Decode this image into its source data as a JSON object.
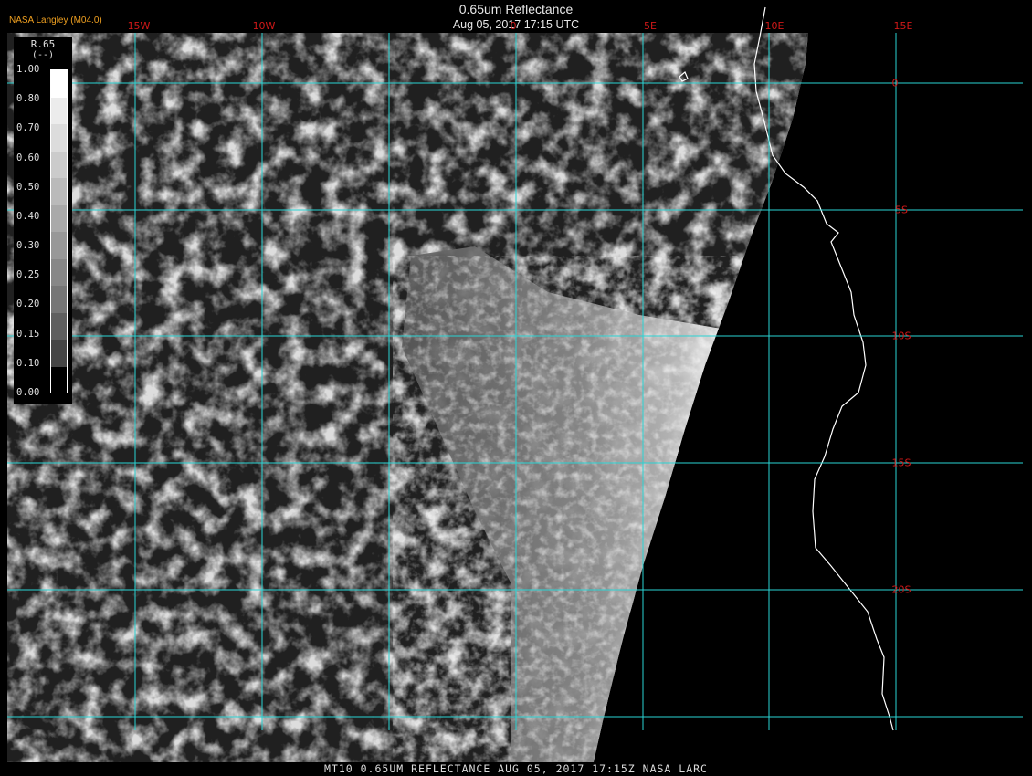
{
  "header": {
    "brand": "NASA Langley (M04.0)",
    "title": "0.65um Reflectance",
    "datetime": "Aug 05, 2017 17:15 UTC"
  },
  "longitude_labels": [
    "15W",
    "10W",
    "0",
    "5E",
    "10E",
    "15E"
  ],
  "latitude_labels": [
    "0",
    "5S",
    "10S",
    "15S",
    "20S"
  ],
  "legend": {
    "name": "R.65",
    "units": "(--)",
    "ticks": [
      "1.00",
      "0.80",
      "0.70",
      "0.60",
      "0.50",
      "0.40",
      "0.30",
      "0.25",
      "0.20",
      "0.15",
      "0.10",
      "0.00"
    ],
    "colors": [
      "#ffffff",
      "#ececec",
      "#dcdcdc",
      "#cbcbcb",
      "#bababa",
      "#a9a9a9",
      "#989898",
      "#878787",
      "#767676",
      "#5f5f5f",
      "#454545",
      "#000000"
    ]
  },
  "footer": "MT10   0.65UM REFLECTANCE    AUG 05, 2017 17:15Z   NASA LARC",
  "colors": {
    "grid": "#2ad4d4",
    "grid_label": "#d01818",
    "brand": "#f0a020",
    "coastline": "#ffffff",
    "background": "#000000"
  }
}
